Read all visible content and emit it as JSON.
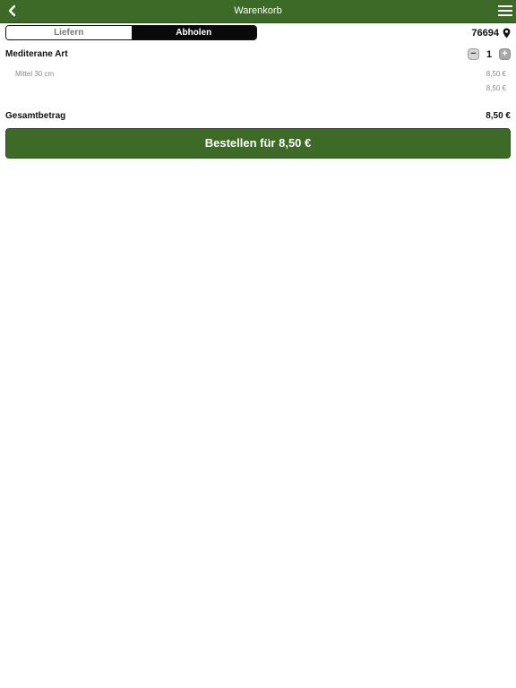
{
  "header": {
    "title": "Warenkorb",
    "back_icon": "chevron-left-icon",
    "menu_icon": "hamburger-menu-icon",
    "bg_color": "#3d6a27"
  },
  "mode_toggle": {
    "options": [
      "Liefern",
      "Abholen"
    ],
    "selected": "Abholen"
  },
  "location": {
    "zip": "76694",
    "icon": "map-pin-icon"
  },
  "cart": {
    "items": [
      {
        "name": "Mediterane Art",
        "quantity": "1",
        "variant": "Mittel 30 cm",
        "variant_price": "8,50 €",
        "item_total": "8,50 €"
      }
    ],
    "minus_symbol": "−",
    "plus_symbol": "+"
  },
  "summary": {
    "total_label": "Gesamtbetrag",
    "total_value": "8,50 €"
  },
  "order_button": {
    "label": "Bestellen für 8,50 €",
    "color": "#3d6a27"
  }
}
